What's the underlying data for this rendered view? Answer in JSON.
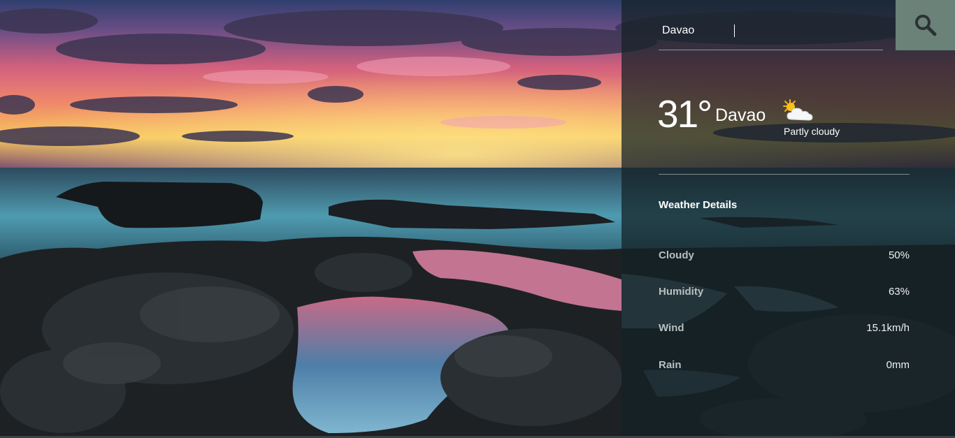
{
  "search": {
    "value": "Davao",
    "button_icon": "search-icon"
  },
  "current": {
    "temperature": "31°",
    "city": "Davao",
    "condition": "Partly cloudy",
    "condition_icon": "partly-cloudy-icon"
  },
  "details": {
    "title": "Weather Details",
    "rows": [
      {
        "label": "Cloudy",
        "value": "50%"
      },
      {
        "label": "Humidity",
        "value": "63%"
      },
      {
        "label": "Wind",
        "value": "15.1km/h"
      },
      {
        "label": "Rain",
        "value": "0mm"
      }
    ]
  },
  "colors": {
    "search_button": "#6b8278",
    "panel_overlay": "#142226"
  }
}
